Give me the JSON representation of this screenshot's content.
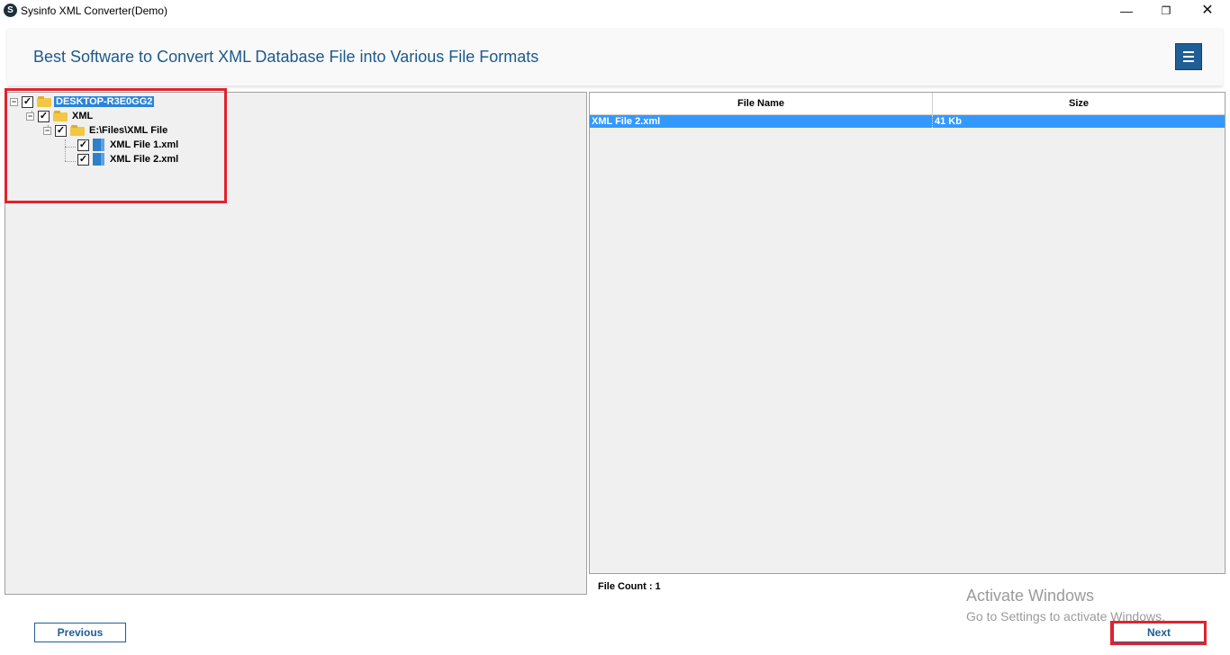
{
  "window": {
    "title": "Sysinfo XML Converter(Demo)",
    "app_icon_letter": "S",
    "controls": {
      "minimize": "—",
      "restore": "❐",
      "close": "✕"
    }
  },
  "header": {
    "title": "Best Software to Convert XML Database File into Various File Formats",
    "menu_icon": "hamburger-icon"
  },
  "tree": {
    "nodes": [
      {
        "label": "DESKTOP-R3E0GG2",
        "checked": true,
        "icon": "computer-folder-icon",
        "selected": true,
        "expandable": true
      },
      {
        "label": "XML",
        "checked": true,
        "icon": "folder-icon",
        "expandable": true
      },
      {
        "label": "E:\\Files\\XML File",
        "checked": true,
        "icon": "folder-icon",
        "expandable": true
      },
      {
        "label": "XML File 1.xml",
        "checked": true,
        "icon": "xml-file-icon"
      },
      {
        "label": "XML File 2.xml",
        "checked": true,
        "icon": "xml-file-icon"
      }
    ]
  },
  "file_table": {
    "columns": [
      "File Name",
      "Size"
    ],
    "rows": [
      {
        "name": "XML File 2.xml",
        "size": "41 Kb",
        "selected": true
      }
    ]
  },
  "file_count": "File Count : 1",
  "buttons": {
    "previous": "Previous",
    "next": "Next"
  },
  "watermark": {
    "title": "Activate Windows",
    "subtitle": "Go to Settings to activate Windows."
  },
  "colors": {
    "accent": "#1f5e96",
    "title_text": "#1c5a8c",
    "selection": "#3399ff",
    "highlight_box": "#e0232e"
  }
}
